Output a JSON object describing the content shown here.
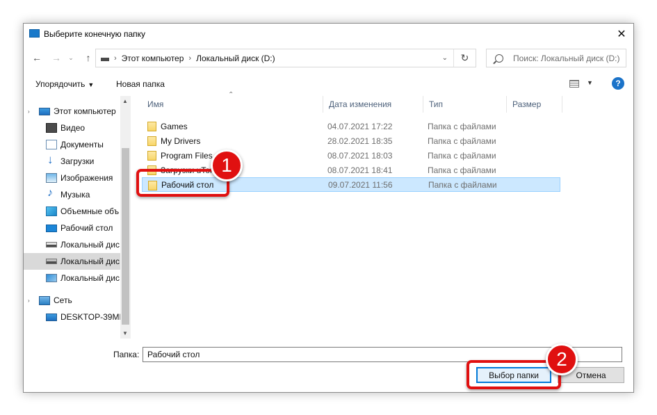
{
  "window": {
    "title": "Выберите конечную папку"
  },
  "navigation": {
    "breadcrumbs": [
      "Этот компьютер",
      "Локальный диск (D:)"
    ],
    "search_placeholder": "Поиск: Локальный диск (D:)"
  },
  "toolbar": {
    "organize_label": "Упорядочить",
    "new_folder_label": "Новая папка"
  },
  "sidebar": {
    "items": [
      {
        "label": "Этот компьютер",
        "icon": "computer-icon"
      },
      {
        "label": "Видео",
        "icon": "video-folder-icon"
      },
      {
        "label": "Документы",
        "icon": "documents-icon"
      },
      {
        "label": "Загрузки",
        "icon": "downloads-icon"
      },
      {
        "label": "Изображения",
        "icon": "pictures-icon"
      },
      {
        "label": "Музыка",
        "icon": "music-icon"
      },
      {
        "label": "Объемные объ",
        "icon": "3d-objects-icon"
      },
      {
        "label": "Рабочий стол",
        "icon": "desktop-icon"
      },
      {
        "label": "Локальный дис",
        "icon": "drive-icon"
      },
      {
        "label": "Локальный дис",
        "icon": "drive-icon",
        "selected": true
      },
      {
        "label": "Локальный дис",
        "icon": "drive-icon"
      },
      {
        "label": "Сеть",
        "icon": "network-icon"
      },
      {
        "label": "DESKTOP-39MH",
        "icon": "computer-icon"
      }
    ]
  },
  "file_list": {
    "columns": [
      "Имя",
      "Дата изменения",
      "Тип",
      "Размер"
    ],
    "rows": [
      {
        "name": "Games",
        "date": "04.07.2021 17:22",
        "type": "Папка с файлами"
      },
      {
        "name": "My Drivers",
        "date": "28.02.2021 18:35",
        "type": "Папка с файлами"
      },
      {
        "name": "Program Files",
        "date": "08.07.2021 18:03",
        "type": "Папка с файлами"
      },
      {
        "name": "Загрузки uTor",
        "date": "08.07.2021 18:41",
        "type": "Папка с файлами"
      },
      {
        "name": "Рабочий стол",
        "date": "09.07.2021 11:56",
        "type": "Папка с файлами",
        "selected": true
      }
    ]
  },
  "footer": {
    "folder_label": "Папка:",
    "folder_value": "Рабочий стол",
    "select_button": "Выбор папки",
    "cancel_button": "Отмена"
  },
  "annotations": {
    "badge_1": "1",
    "badge_2": "2",
    "color": "#e01010"
  }
}
